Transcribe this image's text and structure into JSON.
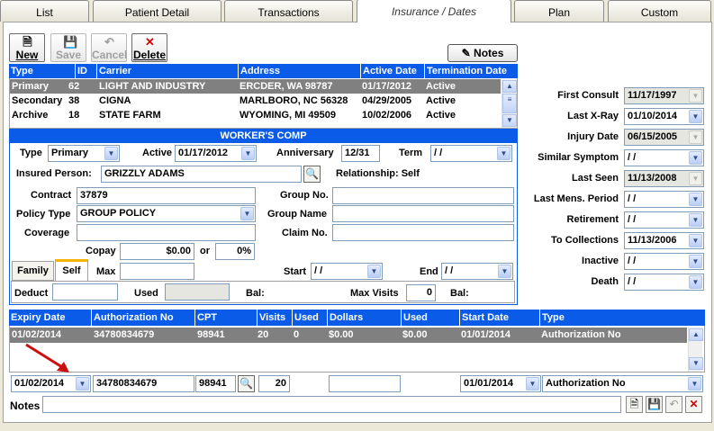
{
  "tabs": [
    "List",
    "Patient Detail",
    "Transactions",
    "Insurance / Dates",
    "Plan",
    "Custom"
  ],
  "toolbar": {
    "new": "New",
    "save": "Save",
    "cancel": "Cancel",
    "delete": "Delete",
    "notes": "Notes"
  },
  "carrier_table": {
    "headers": [
      "Type",
      "ID",
      "Carrier",
      "Address",
      "Active Date",
      "Termination Date"
    ],
    "rows": [
      [
        "Primary",
        "62",
        "LIGHT AND INDUSTRY",
        "ERCDER, WA 98787",
        "01/17/2012",
        "Active"
      ],
      [
        "Secondary",
        "38",
        "CIGNA",
        "MARLBORO, NC 56328",
        "04/29/2005",
        "Active"
      ],
      [
        "Archive",
        "18",
        "STATE FARM",
        "WYOMING, MI 49509",
        "10/02/2006",
        "Active"
      ]
    ]
  },
  "workers_comp": {
    "title": "WORKER'S COMP",
    "type_label": "Type",
    "type_value": "Primary",
    "active_label": "Active",
    "active_value": "01/17/2012",
    "anniv_label": "Anniversary",
    "anniv_value": "12/31",
    "term_label": "Term",
    "term_value": " / /",
    "insured_label": "Insured Person:",
    "insured_value": "GRIZZLY ADAMS",
    "relationship": "Relationship:  Self",
    "contract_label": "Contract",
    "contract_value": "37879",
    "group_no_label": "Group No.",
    "group_no_value": "",
    "policy_label": "Policy Type",
    "policy_value": "GROUP POLICY",
    "group_name_label": "Group Name",
    "group_name_value": "",
    "coverage_label": "Coverage",
    "coverage_value": "",
    "claim_label": "Claim No.",
    "claim_value": "",
    "copay_label": "Copay",
    "copay_value": "$0.00",
    "or_label": "or",
    "pct_value": "0%",
    "family_tab": "Family",
    "self_tab": "Self",
    "max_label": "Max",
    "max_value": "",
    "start_label": "Start",
    "start_value": " / /",
    "end_label": "End",
    "end_value": " / /",
    "deduct_label": "Deduct",
    "deduct_value": "",
    "used_label": "Used",
    "used_value": "",
    "bal_label": "Bal:",
    "bal_value": "",
    "maxvisits_label": "Max Visits",
    "maxvisits_value": "0",
    "bal2_label": "Bal:",
    "bal2_value": ""
  },
  "dates": [
    {
      "label": "First Consult",
      "value": "11/17/1997",
      "disabled": true
    },
    {
      "label": "Last X-Ray",
      "value": "01/10/2014",
      "disabled": false
    },
    {
      "label": "Injury Date",
      "value": "06/15/2005",
      "disabled": true
    },
    {
      "label": "Similar Symptom",
      "value": " / /",
      "disabled": false
    },
    {
      "label": "Last Seen",
      "value": "11/13/2008",
      "disabled": true
    },
    {
      "label": "Last Mens. Period",
      "value": " / /",
      "disabled": false
    },
    {
      "label": "Retirement",
      "value": " / /",
      "disabled": false
    },
    {
      "label": "To Collections",
      "value": "11/13/2006",
      "disabled": false
    },
    {
      "label": "Inactive",
      "value": " / /",
      "disabled": false
    },
    {
      "label": "Death",
      "value": " / /",
      "disabled": false
    }
  ],
  "auth_table": {
    "headers": [
      "Expiry Date",
      "Authorization No",
      "CPT",
      "Visits",
      "Used",
      "Dollars",
      "Used",
      "Start Date",
      "Type"
    ],
    "rows": [
      [
        "01/02/2014",
        "34780834679",
        "98941",
        "20",
        "0",
        "$0.00",
        "$0.00",
        "01/01/2014",
        "Authorization No"
      ]
    ]
  },
  "auth_edit": {
    "expiry": "01/02/2014",
    "auth_no": "34780834679",
    "cpt": "98941",
    "visits": "20",
    "dollars": "",
    "start": "01/01/2014",
    "type": "Authorization No"
  },
  "notes_label": "Notes",
  "notes_value": ""
}
